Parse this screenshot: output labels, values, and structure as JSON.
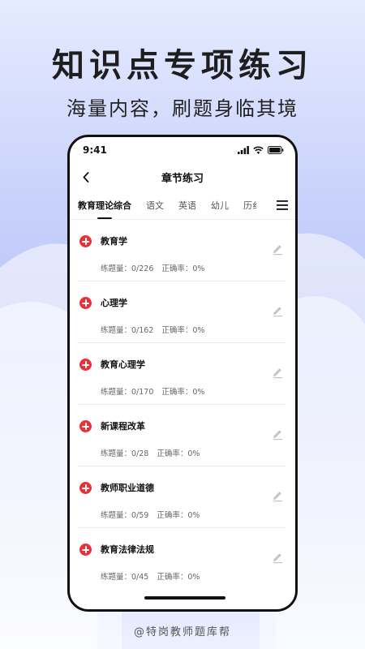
{
  "promo": {
    "headline": "知识点专项练习",
    "subheadline": "海量内容，刷题身临其境",
    "footer": "@特岗教师题库帮"
  },
  "status_bar": {
    "time": "9:41",
    "icons": [
      "signal-icon",
      "wifi-icon",
      "battery-icon"
    ]
  },
  "nav": {
    "title": "章节练习",
    "back_icon": "chevron-left-icon"
  },
  "tabs": [
    {
      "label": "教育理论综合",
      "active": true
    },
    {
      "label": "语文",
      "active": false
    },
    {
      "label": "英语",
      "active": false
    },
    {
      "label": "幼儿",
      "active": false
    },
    {
      "label": "历纟",
      "active": false
    }
  ],
  "menu_icon": "hamburger-menu-icon",
  "items": [
    {
      "title": "教育学",
      "count": "练题量：0/226",
      "accuracy": "正确率：0%"
    },
    {
      "title": "心理学",
      "count": "练题量：0/162",
      "accuracy": "正确率：0%"
    },
    {
      "title": "教育心理学",
      "count": "练题量：0/170",
      "accuracy": "正确率：0%"
    },
    {
      "title": "新课程改革",
      "count": "练题量：0/28",
      "accuracy": "正确率：0%"
    },
    {
      "title": "教师职业道德",
      "count": "练题量：0/59",
      "accuracy": "正确率：0%"
    },
    {
      "title": "教育法律法规",
      "count": "练题量：0/45",
      "accuracy": "正确率：0%"
    }
  ],
  "colors": {
    "accent": "#e8323a",
    "text": "#111111",
    "muted": "#666666"
  }
}
